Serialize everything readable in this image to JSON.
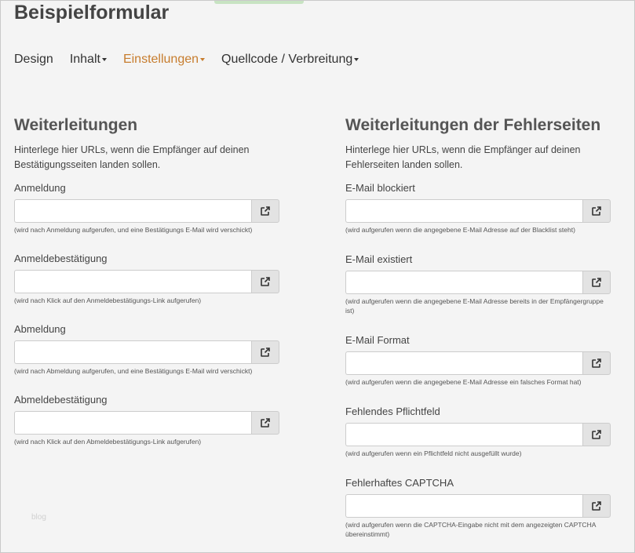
{
  "page": {
    "title": "Beispielformular"
  },
  "nav": {
    "items": [
      {
        "label": "Design",
        "caret": false,
        "active": false
      },
      {
        "label": "Inhalt",
        "caret": true,
        "active": false
      },
      {
        "label": "Einstellungen",
        "caret": true,
        "active": true
      },
      {
        "label": "Quellcode / Verbreitung",
        "caret": true,
        "active": false
      }
    ]
  },
  "left": {
    "title": "Weiterleitungen",
    "description": "Hinterlege hier URLs, wenn die Empfänger auf deinen Bestätigungsseiten landen sollen.",
    "fields": [
      {
        "label": "Anmeldung",
        "value": "",
        "placeholder": "",
        "hint": "(wird nach Anmeldung aufgerufen, und eine Bestätigungs E-Mail wird verschickt)"
      },
      {
        "label": "Anmeldebestätigung",
        "value": "",
        "placeholder": "",
        "hint": "(wird nach Klick auf den Anmeldebestätigungs-Link aufgerufen)"
      },
      {
        "label": "Abmeldung",
        "value": "",
        "placeholder": "",
        "hint": "(wird nach Abmeldung aufgerufen, und eine Bestätigungs E-Mail wird verschickt)"
      },
      {
        "label": "Abmeldebestätigung",
        "value": "",
        "placeholder": "",
        "hint": "(wird nach Klick auf den Abmeldebestätigungs-Link aufgerufen)"
      }
    ]
  },
  "right": {
    "title": "Weiterleitungen der Fehlerseiten",
    "description": "Hinterlege hier URLs, wenn die Empfänger auf deinen Fehlerseiten landen sollen.",
    "fields": [
      {
        "label": "E-Mail blockiert",
        "value": "",
        "placeholder": "",
        "hint": "(wird aufgerufen wenn die angegebene E-Mail Adresse auf der Blacklist steht)"
      },
      {
        "label": "E-Mail existiert",
        "value": "",
        "placeholder": "",
        "hint": "(wird aufgerufen wenn die angegebene E-Mail Adresse bereits in der Empfängergruppe ist)"
      },
      {
        "label": "E-Mail Format",
        "value": "",
        "placeholder": "",
        "hint": "(wird aufgerufen wenn die angegebene E-Mail Adresse ein falsches Format hat)"
      },
      {
        "label": "Fehlendes Pflichtfeld",
        "value": "",
        "placeholder": "",
        "hint": "(wird aufgerufen wenn ein Pflichtfeld nicht ausgefüllt wurde)"
      },
      {
        "label": "Fehlerhaftes CAPTCHA",
        "value": "",
        "placeholder": "",
        "hint": "(wird aufgerufen wenn die CAPTCHA-Eingabe nicht mit dem angezeigten CAPTCHA übereinstimmt)"
      }
    ]
  },
  "watermark": "blog",
  "icons": {
    "open_link": "external-link-icon"
  },
  "colors": {
    "accent": "#c77d2e",
    "background": "#f4f4f4",
    "button": "#e3e3e3"
  }
}
